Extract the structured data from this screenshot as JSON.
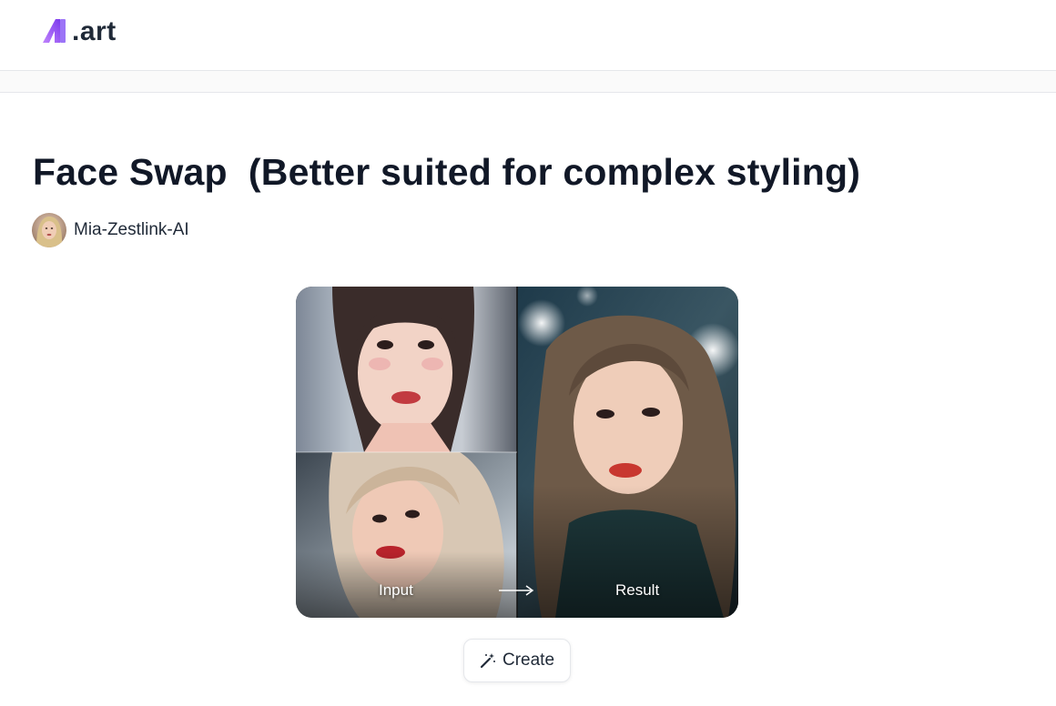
{
  "header": {
    "logo_text": ".art",
    "logo_icon": "a-letter-logo-icon"
  },
  "page": {
    "title": "Face Swap  (Better suited for complex styling)",
    "author": {
      "name": "Mia-Zestlink-AI",
      "avatar_icon": "avatar"
    }
  },
  "preview": {
    "input_label": "Input",
    "result_label": "Result",
    "arrow_icon": "arrow-right-icon"
  },
  "actions": {
    "create_label": "Create",
    "create_icon": "magic-wand-icon"
  },
  "colors": {
    "logo_gradient_start": "#c084fc",
    "logo_gradient_end": "#7c3aed",
    "text_primary": "#111827",
    "border": "#e5e7eb"
  }
}
